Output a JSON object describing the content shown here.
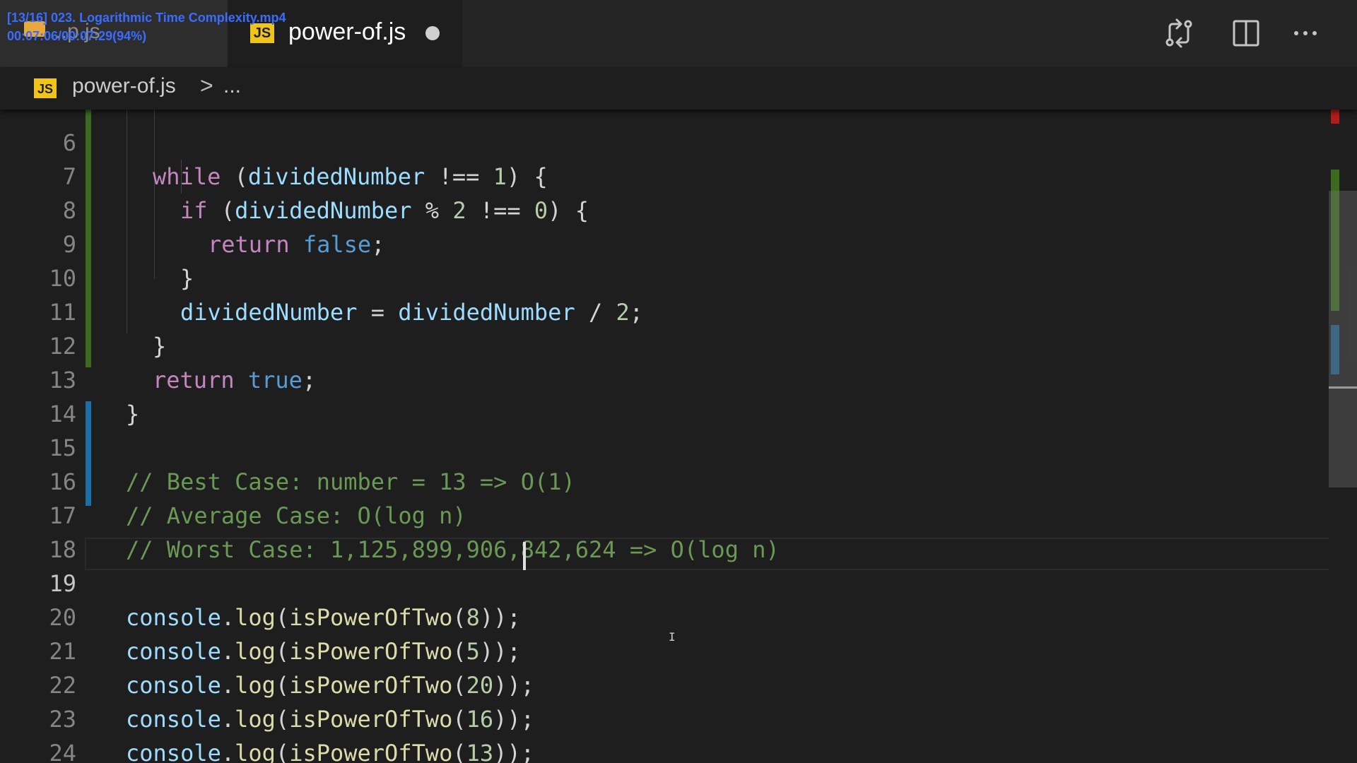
{
  "overlay": {
    "file_line": "[13/16] 023. Logarithmic Time Complexity.mp4",
    "time_line": "00:07:06/00:07:29(94%)"
  },
  "tabs": {
    "prev_label": "...p.js",
    "active_title": "power-of.js",
    "js_badge": "JS"
  },
  "toolbar": {
    "compare_icon": "git-compare-icon",
    "split_icon": "split-editor-icon",
    "more_icon": "more-actions-icon"
  },
  "breadcrumb": {
    "file": "power-of.js",
    "separator": ">",
    "more": "..."
  },
  "editor": {
    "lines": [
      {
        "n": "6",
        "code": "while (dividedNumber !== 1) {"
      },
      {
        "n": "7",
        "code": "if (dividedNumber % 2 !== 0) {"
      },
      {
        "n": "8",
        "code": "return false;"
      },
      {
        "n": "9",
        "code": "}"
      },
      {
        "n": "10",
        "code": "dividedNumber = dividedNumber / 2;"
      },
      {
        "n": "11",
        "code": "}"
      },
      {
        "n": "12",
        "code": "return true;"
      },
      {
        "n": "13",
        "code": "}"
      },
      {
        "n": "14",
        "code": ""
      },
      {
        "n": "15",
        "code": "// Best Case: number = 13 => O(1)"
      },
      {
        "n": "16",
        "code": "// Average Case: O(log n)"
      },
      {
        "n": "17",
        "code": "// Worst Case: 1,125,899,906,842,624 => O(log n)"
      },
      {
        "n": "18",
        "code": ""
      },
      {
        "n": "19",
        "code": "console.log(isPowerOfTwo(8));"
      },
      {
        "n": "20",
        "code": "console.log(isPowerOfTwo(5));"
      },
      {
        "n": "21",
        "code": "console.log(isPowerOfTwo(20));"
      },
      {
        "n": "22",
        "code": "console.log(isPowerOfTwo(16));"
      },
      {
        "n": "23",
        "code": "console.log(isPowerOfTwo(13));"
      },
      {
        "n": "24",
        "code": ""
      }
    ]
  },
  "colors": {
    "keyword": "#c586c0",
    "boolean": "#569cd6",
    "variable": "#9cdcfe",
    "number": "#b5cea8",
    "function": "#dcdcaa",
    "comment": "#6a9955",
    "git_modified": "#3c6b20",
    "git_added": "#1b6fa8"
  }
}
